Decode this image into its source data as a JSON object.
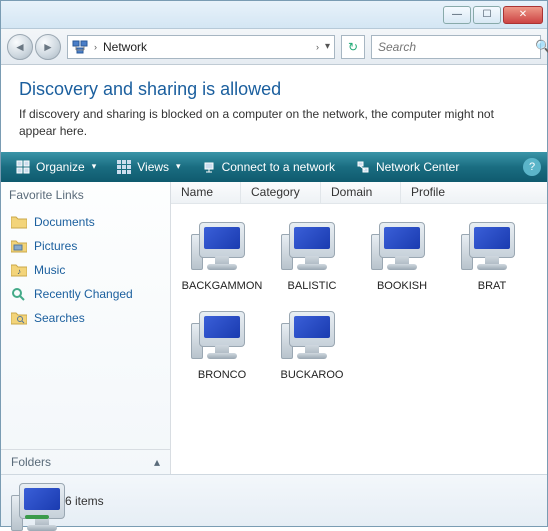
{
  "titlebar": {
    "min": "—",
    "max": "☐",
    "close": "✕"
  },
  "nav": {
    "back": "◄",
    "fwd": "►",
    "breadcrumb_root": "Network",
    "breadcrumb_sep": "›",
    "refresh": "↻",
    "search_placeholder": "Search"
  },
  "info": {
    "heading": "Discovery and sharing is allowed",
    "text": "If discovery and sharing is blocked on a computer on the network, the computer might not appear here."
  },
  "cmdbar": {
    "organize": "Organize",
    "views": "Views",
    "connect": "Connect to a network",
    "center": "Network Center",
    "help": "?"
  },
  "sidebar": {
    "header": "Favorite Links",
    "items": [
      {
        "label": "Documents",
        "icon": "folder"
      },
      {
        "label": "Pictures",
        "icon": "folder-pic"
      },
      {
        "label": "Music",
        "icon": "folder-music"
      },
      {
        "label": "Recently Changed",
        "icon": "search-folder"
      },
      {
        "label": "Searches",
        "icon": "folder-search"
      }
    ],
    "folders": "Folders"
  },
  "columns": [
    "Name",
    "Category",
    "Domain",
    "Profile"
  ],
  "computers": [
    {
      "name": "BACKGAMMON"
    },
    {
      "name": "BALISTIC"
    },
    {
      "name": "BOOKISH"
    },
    {
      "name": "BRAT"
    },
    {
      "name": "BRONCO"
    },
    {
      "name": "BUCKAROO"
    }
  ],
  "status": {
    "text": "6 items"
  }
}
